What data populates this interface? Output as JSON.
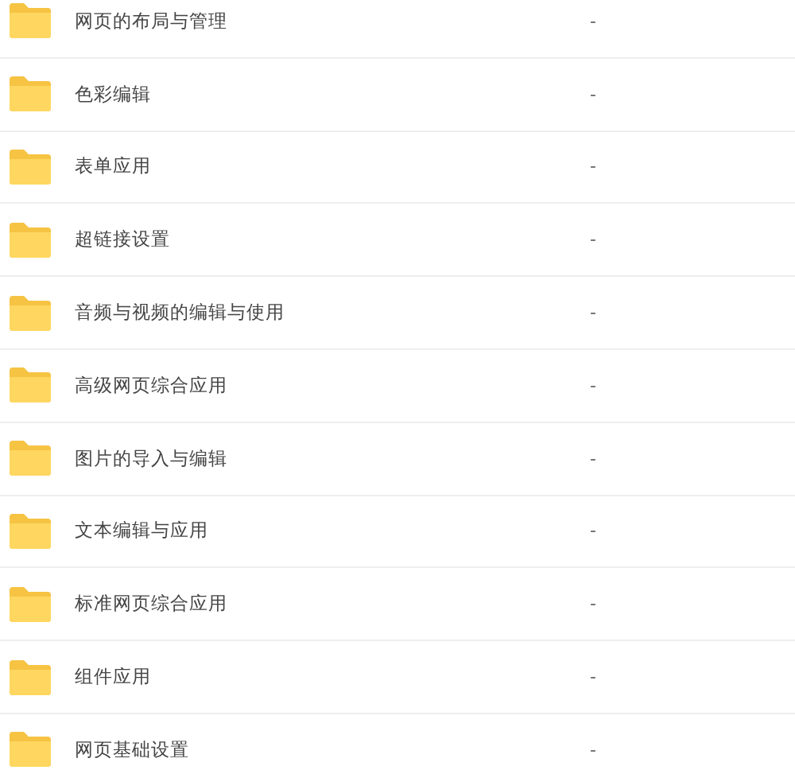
{
  "folders": [
    {
      "name": "网页的布局与管理",
      "column_2": "-"
    },
    {
      "name": "色彩编辑",
      "column_2": "-"
    },
    {
      "name": "表单应用",
      "column_2": "-"
    },
    {
      "name": "超链接设置",
      "column_2": "-"
    },
    {
      "name": "音频与视频的编辑与使用",
      "column_2": "-"
    },
    {
      "name": "高级网页综合应用",
      "column_2": "-"
    },
    {
      "name": "图片的导入与编辑",
      "column_2": "-"
    },
    {
      "name": "文本编辑与应用",
      "column_2": "-"
    },
    {
      "name": "标准网页综合应用",
      "column_2": "-"
    },
    {
      "name": "组件应用",
      "column_2": "-"
    },
    {
      "name": "网页基础设置",
      "column_2": "-"
    }
  ]
}
